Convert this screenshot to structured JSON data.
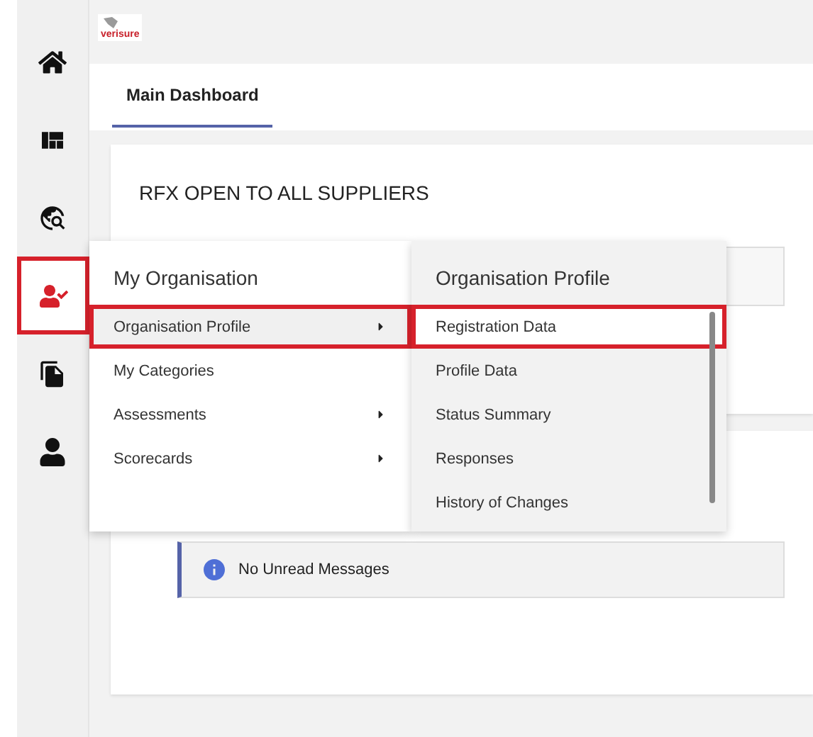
{
  "sidebar": {
    "items": [
      {
        "kind": "home",
        "selected": false
      },
      {
        "kind": "layout",
        "selected": false
      },
      {
        "kind": "globe",
        "selected": false
      },
      {
        "kind": "organisation",
        "selected": true
      },
      {
        "kind": "documents",
        "selected": false
      },
      {
        "kind": "user",
        "selected": false
      }
    ]
  },
  "header": {
    "logo_text": "verisure"
  },
  "tabs": [
    {
      "label": "Main Dashboard",
      "selected": true
    }
  ],
  "cards": [
    {
      "title": "RFX OPEN TO ALL SUPPLIERS"
    }
  ],
  "messages": {
    "text": "No Unread Messages"
  },
  "menu": {
    "title": "My Organisation",
    "items": [
      {
        "label": "Organisation Profile",
        "selected": true,
        "has_submenu": true
      },
      {
        "label": "My Categories",
        "selected": false,
        "has_submenu": false
      },
      {
        "label": "Assessments",
        "selected": false,
        "has_submenu": true
      },
      {
        "label": "Scorecards",
        "selected": false,
        "has_submenu": true
      }
    ]
  },
  "submenu": {
    "title": "Organisation Profile",
    "items": [
      {
        "label": "Registration Data",
        "selected": true
      },
      {
        "label": "Profile Data",
        "selected": false
      },
      {
        "label": "Status Summary",
        "selected": false
      },
      {
        "label": "Responses",
        "selected": false
      },
      {
        "label": "History of Changes",
        "selected": false
      }
    ]
  }
}
